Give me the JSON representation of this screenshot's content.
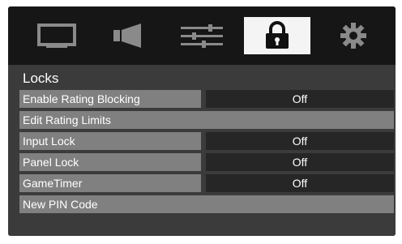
{
  "tabs": [
    {
      "icon": "picture-icon",
      "active": false
    },
    {
      "icon": "speaker-icon",
      "active": false
    },
    {
      "icon": "sliders-icon",
      "active": false
    },
    {
      "icon": "lock-icon",
      "active": true
    },
    {
      "icon": "gear-icon",
      "active": false
    }
  ],
  "colors": {
    "tab_bar": "#161616",
    "active_tab": "#f4f4f4",
    "panel": "#3b3b3b",
    "label_bg": "#808080",
    "value_bg": "#262626",
    "text": "#ffffff"
  },
  "menu": {
    "title": "Locks",
    "items": [
      {
        "label": "Enable Rating Blocking",
        "value": "Off"
      },
      {
        "label": "Edit Rating Limits"
      },
      {
        "label": "Input Lock",
        "value": "Off"
      },
      {
        "label": "Panel Lock",
        "value": "Off"
      },
      {
        "label": "GameTimer",
        "value": "Off"
      },
      {
        "label": "New PIN Code"
      }
    ]
  }
}
